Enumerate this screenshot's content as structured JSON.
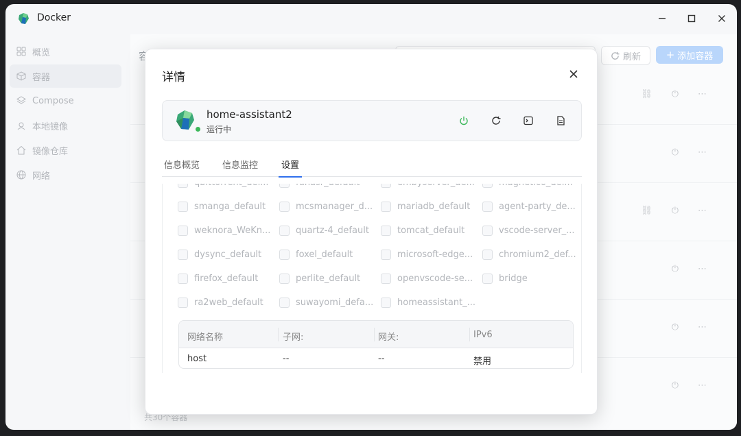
{
  "app": {
    "title": "Docker"
  },
  "window_controls": {
    "minimize": "–",
    "maximize": "☐",
    "close": "✕"
  },
  "sidebar": {
    "items": [
      {
        "label": "概览",
        "icon": "grid-icon",
        "active": false
      },
      {
        "label": "容器",
        "icon": "cube-icon",
        "active": true
      },
      {
        "label": "Compose",
        "icon": "layers-icon",
        "active": false
      },
      {
        "label": "本地镜像",
        "icon": "image-icon",
        "active": false
      },
      {
        "label": "镜像仓库",
        "icon": "home-icon",
        "active": false
      },
      {
        "label": "网络",
        "icon": "globe-icon",
        "active": false
      }
    ]
  },
  "main": {
    "title": "容器",
    "refresh_label": "刷新",
    "add_label": "添加容器",
    "total_label": "共30个容器"
  },
  "modal": {
    "title": "详情",
    "container": {
      "name": "home-assistant2",
      "status": "运行中"
    },
    "tabs": [
      {
        "label": "信息概览",
        "active": false
      },
      {
        "label": "信息监控",
        "active": false
      },
      {
        "label": "设置",
        "active": true
      }
    ],
    "networks": [
      [
        "qbittorrent_def...",
        "funasr_default",
        "embyserver_de...",
        "magnetico_def..."
      ],
      [
        "smanga_default",
        "mcsmanager_d...",
        "mariadb_default",
        "agent-party_de..."
      ],
      [
        "weknora_WeKn...",
        "quartz-4_default",
        "tomcat_default",
        "vscode-server_..."
      ],
      [
        "dysync_default",
        "foxel_default",
        "microsoft-edge...",
        "chromium2_def..."
      ],
      [
        "firefox_default",
        "perlite_default",
        "openvscode-se...",
        "bridge"
      ],
      [
        "ra2web_default",
        "suwayomi_defa...",
        "homeassistant_..."
      ]
    ],
    "net_table": {
      "headers": [
        "网络名称",
        "子网:",
        "网关:",
        "IPv6"
      ],
      "row": [
        "host",
        "--",
        "--",
        "禁用"
      ]
    }
  },
  "colors": {
    "accent": "#2f6fed",
    "running": "#3cb85a",
    "add_button": "#b9d6fb"
  }
}
